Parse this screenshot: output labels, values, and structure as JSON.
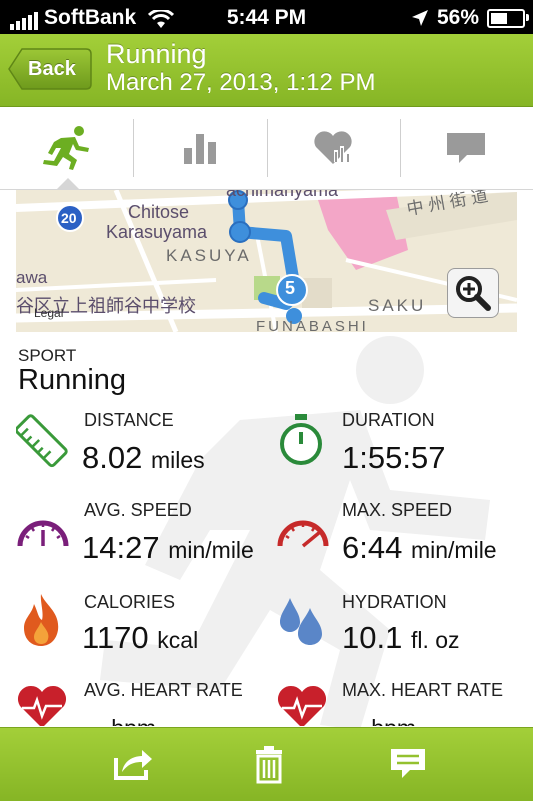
{
  "status_bar": {
    "carrier": "SoftBank",
    "time": "5:44 PM",
    "battery": "56%",
    "battery_level": 0.56
  },
  "nav": {
    "back_label": "Back",
    "title": "Running",
    "subtitle": "March 27, 2013, 1:12 PM"
  },
  "tabs": [
    {
      "icon": "runner-icon",
      "selected": true
    },
    {
      "icon": "bar-chart-icon",
      "selected": false
    },
    {
      "icon": "heart-chart-icon",
      "selected": false
    },
    {
      "icon": "comment-icon",
      "selected": false
    }
  ],
  "map": {
    "labels": [
      "Chitose",
      "Karasuyama",
      "KASUYA",
      "SAKU",
      "FUNABASHI",
      "achimanyama",
      "awa",
      "20",
      "谷区立上祖師谷中学校",
      "中 州 街 道"
    ],
    "legal": "Legal",
    "marker": "5",
    "colors": {
      "route": "#3e8fdc",
      "park": "#b8d98a",
      "pink_area": "#f0a9c8",
      "road": "#ffffff"
    }
  },
  "sport": {
    "label": "SPORT",
    "value": "Running"
  },
  "stats": {
    "distance": {
      "label": "DISTANCE",
      "value": "8.02",
      "unit": "miles"
    },
    "duration": {
      "label": "DURATION",
      "value": "1:55:57",
      "unit": ""
    },
    "avg_speed": {
      "label": "AVG. SPEED",
      "value": "14:27",
      "unit": "min/mile"
    },
    "max_speed": {
      "label": "MAX. SPEED",
      "value": "6:44",
      "unit": "min/mile"
    },
    "calories": {
      "label": "CALORIES",
      "value": "1170",
      "unit": "kcal"
    },
    "hydration": {
      "label": "HYDRATION",
      "value": "10.1",
      "unit": "fl. oz"
    },
    "avg_hr": {
      "label": "AVG. HEART RATE",
      "value": "--",
      "unit": "bpm"
    },
    "max_hr": {
      "label": "MAX. HEART RATE",
      "value": "--",
      "unit": "bpm"
    }
  },
  "toolbar": {
    "icons": [
      "share-icon",
      "trash-icon",
      "comment-icon"
    ]
  },
  "colors": {
    "accent": "#94c12f",
    "duration_green": "#2a8a3a",
    "speed_purple": "#7a1f7a",
    "speed_red": "#c62a2a",
    "calorie_orange": "#e05a1e",
    "hydration_blue": "#5a86c8",
    "heart_red": "#c8202b",
    "distance_green": "#3a9a3a"
  }
}
